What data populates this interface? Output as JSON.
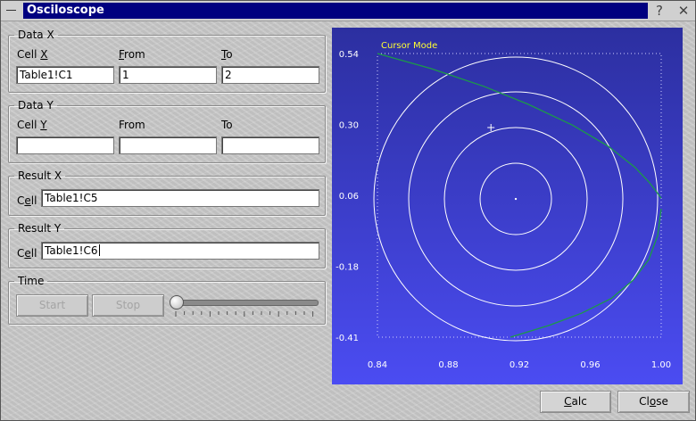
{
  "window": {
    "title": "Osciloscope",
    "help_glyph": "?",
    "close_glyph": "✕"
  },
  "data_x": {
    "legend": "Data X",
    "cell_label_prefix": "Cell ",
    "cell_label_mnemonic": "X",
    "from_label_mnemonic": "F",
    "from_label_rest": "rom",
    "to_label_mnemonic": "T",
    "to_label_rest": "o",
    "cell_value": "Table1!C1",
    "from_value": "1",
    "to_value": "2"
  },
  "data_y": {
    "legend": "Data Y",
    "cell_label_prefix": "Cell ",
    "cell_label_mnemonic": "Y",
    "from_label": "From",
    "to_label": "To",
    "cell_value": "",
    "from_value": "",
    "to_value": ""
  },
  "result_x": {
    "legend": "Result X",
    "label_start": "C",
    "label_mnemonic": "e",
    "label_end": "ll",
    "value": "Table1!C5"
  },
  "result_y": {
    "legend": "Result Y",
    "label_start": "C",
    "label_mnemonic": "e",
    "label_end": "ll",
    "value": "Table1!C6"
  },
  "time": {
    "legend": "Time",
    "start_label": "Start",
    "stop_label": "Stop",
    "start_enabled": false,
    "stop_enabled": false,
    "slider_value": 0
  },
  "buttons": {
    "calc_mnemonic": "C",
    "calc_rest": "alc",
    "close_start": "Cl",
    "close_mnemonic": "o",
    "close_end": "se"
  },
  "chart_data": {
    "type": "line",
    "mode_label": "Cursor Mode",
    "x_ticks": [
      "0.84",
      "0.88",
      "0.92",
      "0.96",
      "1.00"
    ],
    "y_ticks": [
      "0.54",
      "0.30",
      "0.06",
      "-0.18",
      "-0.41"
    ],
    "xlim": [
      0.84,
      1.0
    ],
    "ylim": [
      -0.41,
      0.54
    ],
    "background_top": "#2c2fa0",
    "background_bottom": "#4b4cf2",
    "ring_color": "#ffffff",
    "curve_color": "#1c9a48",
    "label_color": "#ffff33",
    "series": [
      {
        "values_x": [
          0.84,
          0.87,
          0.9,
          0.925,
          0.95,
          0.97,
          0.985,
          0.993,
          0.997,
          1.0
        ],
        "values_y": [
          0.54,
          0.49,
          0.43,
          0.37,
          0.3,
          0.23,
          0.16,
          0.11,
          0.08,
          0.055
        ]
      },
      {
        "values_x": [
          1.0,
          0.998,
          0.993,
          0.984,
          0.972,
          0.955,
          0.937,
          0.915
        ],
        "values_y": [
          0.02,
          -0.07,
          -0.15,
          -0.22,
          -0.28,
          -0.33,
          -0.37,
          -0.41
        ]
      }
    ],
    "cursor": {
      "x": 0.904,
      "y": 0.292
    },
    "center_marker": {
      "x": 0.918,
      "y": 0.053
    }
  }
}
